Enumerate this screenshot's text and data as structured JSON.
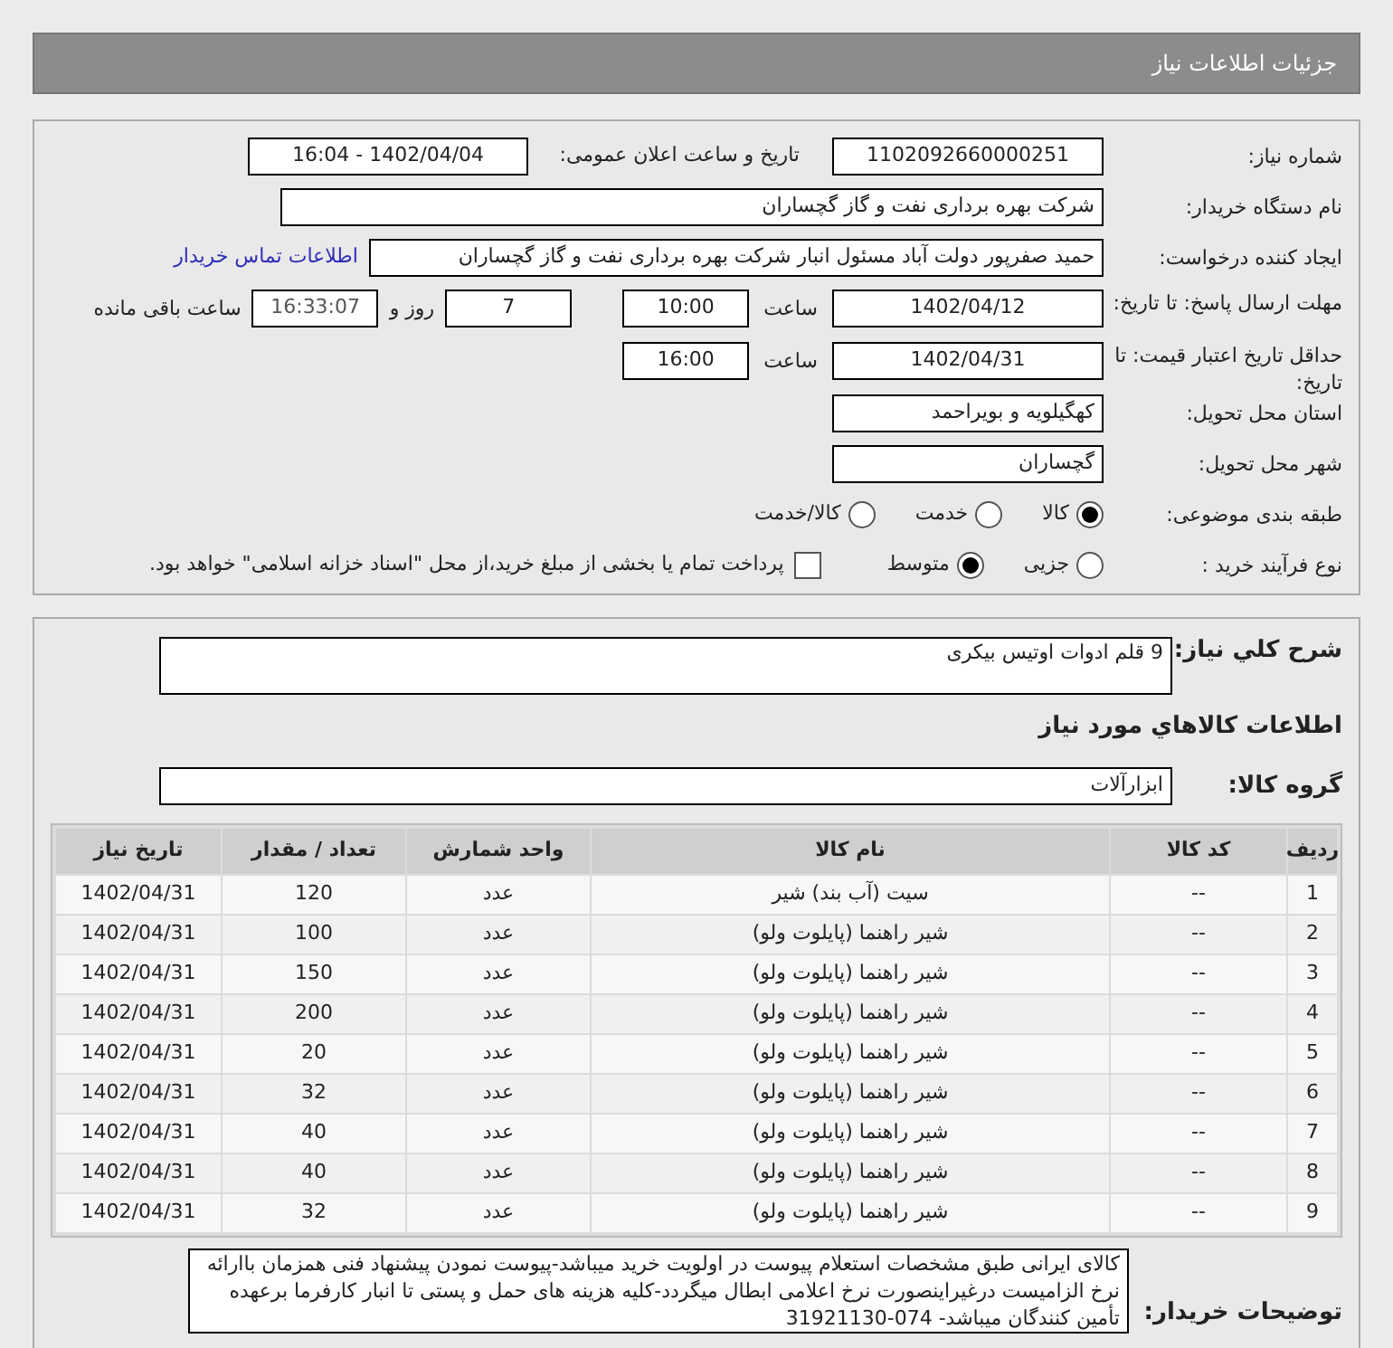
{
  "title": "جزئیات اطلاعات نیاز",
  "need_number": {
    "label": "شماره نیاز:",
    "value": "1102092660000251"
  },
  "announce": {
    "label": "تاریخ و ساعت اعلان عمومی:",
    "value": "1402/04/04 - 16:04"
  },
  "buyer_org": {
    "label": "نام دستگاه خریدار:",
    "value": "شرکت بهره برداری نفت و گاز گچساران"
  },
  "creator": {
    "label": "ایجاد کننده درخواست:",
    "value": "حمید  صفرپور دولت آباد مسئول انبار شرکت بهره برداری نفت و گاز گچساران",
    "link": "اطلاعات تماس خریدار"
  },
  "deadline": {
    "label": "مهلت ارسال پاسخ: تا تاریخ:",
    "date": "1402/04/12",
    "time_label": "ساعت",
    "time": "10:00",
    "days": "7",
    "days_label": "روز و",
    "remaining": "16:33:07",
    "remaining_label": "ساعت باقی مانده"
  },
  "validity": {
    "label": "حداقل تاریخ اعتبار قیمت: تا تاریخ:",
    "date": "1402/04/31",
    "time_label": "ساعت",
    "time": "16:00"
  },
  "province": {
    "label": "استان محل تحویل:",
    "value": "کهگیلویه و بویراحمد"
  },
  "city": {
    "label": "شهر محل تحویل:",
    "value": "گچساران"
  },
  "category": {
    "label": "طبقه بندی موضوعی:",
    "options": [
      {
        "label": "کالا",
        "selected": true
      },
      {
        "label": "خدمت",
        "selected": false
      },
      {
        "label": "کالا/خدمت",
        "selected": false
      }
    ]
  },
  "process": {
    "label": "نوع فرآیند خرید :",
    "options": [
      {
        "label": "جزیی",
        "selected": false
      },
      {
        "label": "متوسط",
        "selected": true
      }
    ],
    "treasury": {
      "label": "پرداخت تمام یا بخشی از مبلغ خرید،از محل \"اسناد خزانه اسلامی\" خواهد بود.",
      "checked": false
    }
  },
  "summary": {
    "label": "شرح کلي نياز:",
    "value": "9 قلم ادوات اوتیس بیکری"
  },
  "goods_heading": "اطلاعات کالاهاي مورد نياز",
  "goods_group": {
    "label": "گروه کالا:",
    "value": "ابزارآلات"
  },
  "table": {
    "columns": [
      "ردیف",
      "کد کالا",
      "نام کالا",
      "واحد شمارش",
      "تعداد / مقدار",
      "تاریخ نیاز"
    ],
    "rows": [
      [
        "1",
        "--",
        "سیت (آب بند) شیر",
        "عدد",
        "120",
        "1402/04/31"
      ],
      [
        "2",
        "--",
        "شیر راهنما (پایلوت ولو)",
        "عدد",
        "100",
        "1402/04/31"
      ],
      [
        "3",
        "--",
        "شیر راهنما (پایلوت ولو)",
        "عدد",
        "150",
        "1402/04/31"
      ],
      [
        "4",
        "--",
        "شیر راهنما (پایلوت ولو)",
        "عدد",
        "200",
        "1402/04/31"
      ],
      [
        "5",
        "--",
        "شیر راهنما (پایلوت ولو)",
        "عدد",
        "20",
        "1402/04/31"
      ],
      [
        "6",
        "--",
        "شیر راهنما (پایلوت ولو)",
        "عدد",
        "32",
        "1402/04/31"
      ],
      [
        "7",
        "--",
        "شیر راهنما (پایلوت ولو)",
        "عدد",
        "40",
        "1402/04/31"
      ],
      [
        "8",
        "--",
        "شیر راهنما (پایلوت ولو)",
        "عدد",
        "40",
        "1402/04/31"
      ],
      [
        "9",
        "--",
        "شیر راهنما (پایلوت ولو)",
        "عدد",
        "32",
        "1402/04/31"
      ]
    ]
  },
  "buyer_notes": {
    "label": "توضیحات خریدار:",
    "value": "کالای ایرانی طبق مشخصات استعلام پیوست در اولویت خرید میباشد-پیوست نمودن پیشنهاد فنی همزمان باارائه نرخ الزامیست درغیراینصورت نرخ اعلامی ابطال میگردد-کلیه هزینه های حمل و پستی تا انبار کارفرما برعهده تأمین کنندگان میباشد- 074-31921130"
  }
}
